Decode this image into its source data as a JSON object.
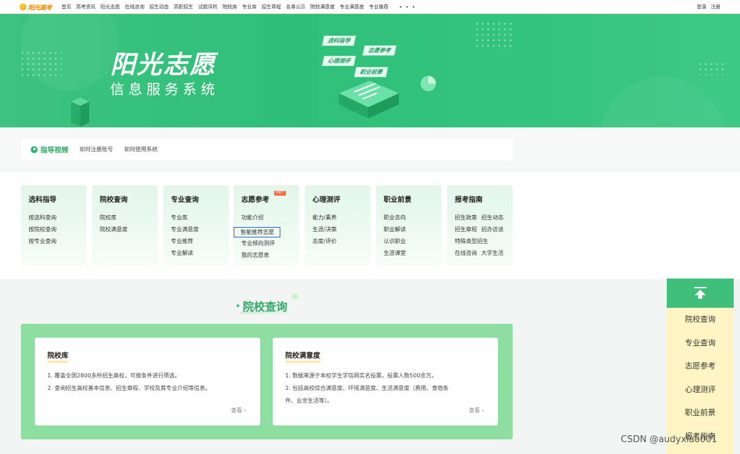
{
  "brand": {
    "logo_text": "阳光高考"
  },
  "nav": {
    "items": [
      "首页",
      "高考资讯",
      "阳光志愿",
      "在线咨询",
      "招生动态",
      "高职招生",
      "试题评析",
      "院校库",
      "专业库",
      "招生章程",
      "名单公示",
      "院校满意度",
      "专业满意度",
      "专业推荐"
    ],
    "more": "• • •",
    "login": "登录",
    "register": "注册"
  },
  "banner": {
    "title": "阳光志愿",
    "subtitle": "信息服务系统",
    "tags": [
      "选科指导",
      "志愿参考",
      "心理测评",
      "职业前景"
    ]
  },
  "guide": {
    "title": "指导视频",
    "links": [
      "如何注册账号",
      "如何使用系统"
    ]
  },
  "categories": [
    {
      "title": "选科指导",
      "links": [
        "按选科查询",
        "按院校查询",
        "按专业查询"
      ]
    },
    {
      "title": "院校查询",
      "links": [
        "院校库",
        "院校满意度"
      ]
    },
    {
      "title": "专业查询",
      "links": [
        "专业库",
        "专业满意度",
        "专业推荐",
        "专业解读"
      ]
    },
    {
      "title": "志愿参考",
      "badge": "HOT",
      "links": [
        "功能介绍",
        "智能推荐志愿",
        "专业倾向测评",
        "我的志愿表"
      ],
      "selected": 1
    },
    {
      "title": "心理测评",
      "links": [
        "能力/素养",
        "生涯/决策",
        "态度/评价"
      ]
    },
    {
      "title": "职业前景",
      "links": [
        "职业去向",
        "职业解读",
        "认识职业",
        "生涯课堂"
      ]
    },
    {
      "title": "报考指南",
      "rows": [
        [
          "招生政策",
          "招生动态"
        ],
        [
          "招生章程",
          "招办访谈"
        ],
        [
          "特殊类型招生"
        ],
        [
          "在线咨询",
          "大学生活"
        ]
      ]
    }
  ],
  "section": {
    "title": "院校查询",
    "cards": [
      {
        "title": "院校库",
        "lines": [
          "1. 覆盖全国2800多所招生高校，可按条件进行筛选。",
          "2. 查询招生高校基本信息、招生章程、学校及其专业介绍等信息。"
        ],
        "more": "查看 ›"
      },
      {
        "title": "院校满意度",
        "lines": [
          "1. 数据来源于本校学生学信网实名投票，投票人数500余万。",
          "2. 包括高校综合满意度、环境满意度、生活满意度（费用、食宿条",
          "件、业余生活等）。"
        ],
        "more": "查看 ›"
      }
    ]
  },
  "sidenav": {
    "items": [
      "院校查询",
      "专业查询",
      "志愿参考",
      "心理测评",
      "职业前景",
      "报考指南"
    ]
  },
  "watermark": "CSDN @audyxiao001",
  "colors": {
    "primary": "#3cc37f",
    "accent_text": "#2fa866",
    "card_bg": "#8edea2",
    "side_bg": "#fff4c4",
    "hot": "#ff6a3d"
  }
}
